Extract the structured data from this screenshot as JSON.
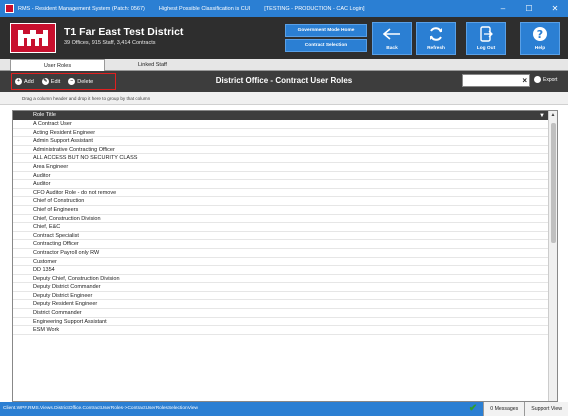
{
  "window": {
    "title_parts": [
      "RMS - Resident Management System (Patch: 0567)",
      "Highest Possible Classification is CUI",
      "[TESTING - PRODUCTION - CAC Login]"
    ],
    "minimize": "–",
    "close": "✕"
  },
  "header": {
    "district_name": "T1 Far East Test District",
    "district_sub": "39 Offices, 915 Staff, 3,414 Contracts",
    "gov_mode": "Government Mode Home",
    "contract_selection": "Contract Selection",
    "buttons": {
      "back": "Back",
      "refresh": "Refresh",
      "logout": "Log Out",
      "help": "Help"
    }
  },
  "tabs": [
    "User Roles",
    "Linked Staff"
  ],
  "toolbar": {
    "add": "Add",
    "edit": "Edit",
    "delete": "Delete",
    "title": "District Office - Contract User Roles",
    "search_value": "",
    "export": "Export"
  },
  "grid": {
    "group_hint": "Drag a column header and drop it here to group by that column",
    "column": "Role Title",
    "rows": [
      "A Contract User",
      "Acting Resident Engineer",
      "Admin Support Assistant",
      "Administrative Contracting Officer",
      "ALL ACCESS BUT NO SECURITY CLASS",
      "Area Engineer",
      "Auditor",
      "Auditor",
      "CFO Auditor Role - do not remove",
      "Chief of Construction",
      "Chief of Engineers",
      "Chief, Construction Division",
      "Chief, E&C",
      "Contract Specialist",
      "Contracting Officer",
      "Contractor Payroll only RW",
      "Customer",
      "DD 1354",
      "Deputy Chief, Construction Division",
      "Deputy District Commander",
      "Deputy District Engineer",
      "Deputy Resident Engineer",
      "District Commander",
      "Engineering Support Assistant",
      "ESM Work"
    ]
  },
  "status": {
    "path": "Client.WPF.RMS.Views.DistrictOffice.ContractUserRoles->ContractUserRolesSelectionView",
    "messages": "0 Messages",
    "support": "Support View"
  }
}
